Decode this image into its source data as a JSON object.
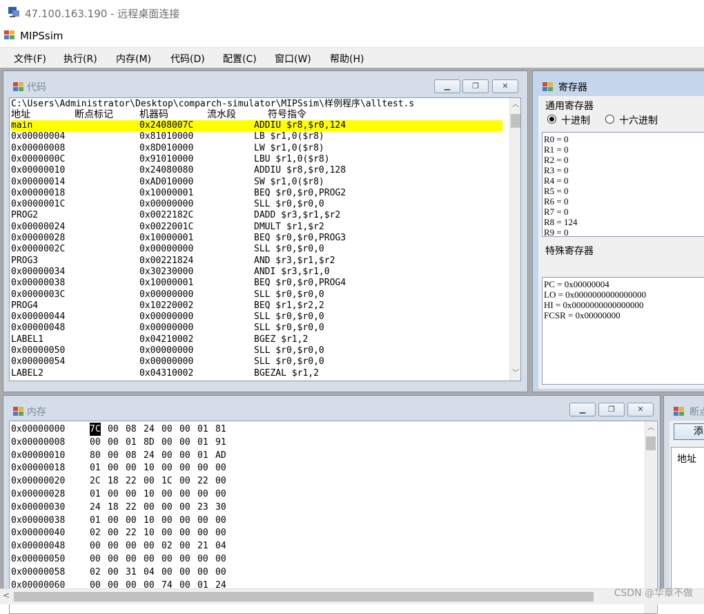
{
  "remote_window": {
    "title": "47.100.163.190 - 远程桌面连接",
    "icon": "remote-desktop-icon"
  },
  "app": {
    "title": "MIPSsim",
    "icon": "app-icon"
  },
  "menu": [
    "文件(F)",
    "执行(R)",
    "内存(M)",
    "代码(D)",
    "配置(C)",
    "窗口(W)",
    "帮助(H)"
  ],
  "code_window": {
    "title": "代码",
    "path": "C:\\Users\\Administrator\\Desktop\\comparch-simulator\\MIPSsim\\样例程序\\alltest.s",
    "headers": [
      "地址",
      "断点标记",
      "机器码",
      "流水段",
      "符号指令"
    ],
    "rows": [
      {
        "addr": "main",
        "code": "0x2408007C",
        "instr": "ADDIU $r8,$r0,124",
        "highlight": true
      },
      {
        "addr": "0x00000004",
        "code": "0x81010000",
        "instr": "LB $r1,0($r8)"
      },
      {
        "addr": "0x00000008",
        "code": "0x8D010000",
        "instr": "LW $r1,0($r8)"
      },
      {
        "addr": "0x0000000C",
        "code": "0x91010000",
        "instr": "LBU $r1,0($r8)"
      },
      {
        "addr": "0x00000010",
        "code": "0x24080080",
        "instr": "ADDIU $r8,$r0,128"
      },
      {
        "addr": "0x00000014",
        "code": "0xAD010000",
        "instr": "SW $r1,0($r8)"
      },
      {
        "addr": "0x00000018",
        "code": "0x10000001",
        "instr": "BEQ $r0,$r0,PROG2"
      },
      {
        "addr": "0x0000001C",
        "code": "0x00000000",
        "instr": "SLL $r0,$r0,0"
      },
      {
        "addr": "PROG2",
        "code": "0x0022182C",
        "instr": "DADD $r3,$r1,$r2"
      },
      {
        "addr": "0x00000024",
        "code": "0x0022001C",
        "instr": "DMULT $r1,$r2"
      },
      {
        "addr": "0x00000028",
        "code": "0x10000001",
        "instr": "BEQ $r0,$r0,PROG3"
      },
      {
        "addr": "0x0000002C",
        "code": "0x00000000",
        "instr": "SLL $r0,$r0,0"
      },
      {
        "addr": "PROG3",
        "code": "0x00221824",
        "instr": "AND $r3,$r1,$r2"
      },
      {
        "addr": "0x00000034",
        "code": "0x30230000",
        "instr": "ANDI $r3,$r1,0"
      },
      {
        "addr": "0x00000038",
        "code": "0x10000001",
        "instr": "BEQ $r0,$r0,PROG4"
      },
      {
        "addr": "0x0000003C",
        "code": "0x00000000",
        "instr": "SLL $r0,$r0,0"
      },
      {
        "addr": "PROG4",
        "code": "0x10220002",
        "instr": "BEQ $r1,$r2,2"
      },
      {
        "addr": "0x00000044",
        "code": "0x00000000",
        "instr": "SLL $r0,$r0,0"
      },
      {
        "addr": "0x00000048",
        "code": "0x00000000",
        "instr": "SLL $r0,$r0,0"
      },
      {
        "addr": "LABEL1",
        "code": "0x04210002",
        "instr": "BGEZ $r1,2"
      },
      {
        "addr": "0x00000050",
        "code": "0x00000000",
        "instr": "SLL $r0,$r0,0"
      },
      {
        "addr": "0x00000054",
        "code": "0x00000000",
        "instr": "SLL $r0,$r0,0"
      },
      {
        "addr": "LABEL2",
        "code": "0x04310002",
        "instr": "BGEZAL $r1,2"
      }
    ]
  },
  "register_window": {
    "title": "寄存器",
    "general_label": "通用寄存器",
    "radio_decimal": "十进制",
    "radio_hex": "十六进制",
    "selected_mode": "decimal",
    "general": [
      "R0 = 0",
      "R1 = 0",
      "R2 = 0",
      "R3 = 0",
      "R4 = 0",
      "R5 = 0",
      "R6 = 0",
      "R7 = 0",
      "R8 = 124",
      "R9 = 0"
    ],
    "special_label": "特殊寄存器",
    "special": [
      "PC = 0x00000004",
      "LO = 0x0000000000000000",
      "HI = 0x0000000000000000",
      "FCSR = 0x00000000"
    ]
  },
  "memory_window": {
    "title": "内存",
    "rows": [
      {
        "addr": "0x00000000",
        "bytes": [
          "7C",
          "00",
          "08",
          "24",
          "00",
          "00",
          "01",
          "81"
        ]
      },
      {
        "addr": "0x00000008",
        "bytes": [
          "00",
          "00",
          "01",
          "8D",
          "00",
          "00",
          "01",
          "91"
        ]
      },
      {
        "addr": "0x00000010",
        "bytes": [
          "80",
          "00",
          "08",
          "24",
          "00",
          "00",
          "01",
          "AD"
        ]
      },
      {
        "addr": "0x00000018",
        "bytes": [
          "01",
          "00",
          "00",
          "10",
          "00",
          "00",
          "00",
          "00"
        ]
      },
      {
        "addr": "0x00000020",
        "bytes": [
          "2C",
          "18",
          "22",
          "00",
          "1C",
          "00",
          "22",
          "00"
        ]
      },
      {
        "addr": "0x00000028",
        "bytes": [
          "01",
          "00",
          "00",
          "10",
          "00",
          "00",
          "00",
          "00"
        ]
      },
      {
        "addr": "0x00000030",
        "bytes": [
          "24",
          "18",
          "22",
          "00",
          "00",
          "00",
          "23",
          "30"
        ]
      },
      {
        "addr": "0x00000038",
        "bytes": [
          "01",
          "00",
          "00",
          "10",
          "00",
          "00",
          "00",
          "00"
        ]
      },
      {
        "addr": "0x00000040",
        "bytes": [
          "02",
          "00",
          "22",
          "10",
          "00",
          "00",
          "00",
          "00"
        ]
      },
      {
        "addr": "0x00000048",
        "bytes": [
          "00",
          "00",
          "00",
          "00",
          "02",
          "00",
          "21",
          "04"
        ]
      },
      {
        "addr": "0x00000050",
        "bytes": [
          "00",
          "00",
          "00",
          "00",
          "00",
          "00",
          "00",
          "00"
        ]
      },
      {
        "addr": "0x00000058",
        "bytes": [
          "02",
          "00",
          "31",
          "04",
          "00",
          "00",
          "00",
          "00"
        ]
      },
      {
        "addr": "0x00000060",
        "bytes": [
          "00",
          "00",
          "00",
          "00",
          "74",
          "00",
          "01",
          "24"
        ]
      }
    ],
    "selected_byte": "7C"
  },
  "breakpoint_window": {
    "title": "断点",
    "add_button": "添",
    "column_header": "地址"
  },
  "watermark": "CSDN @华章不做",
  "colors": {
    "highlight": "#ffff00",
    "mdi_background": "#ababab",
    "menubar": "#f0f0f0"
  }
}
